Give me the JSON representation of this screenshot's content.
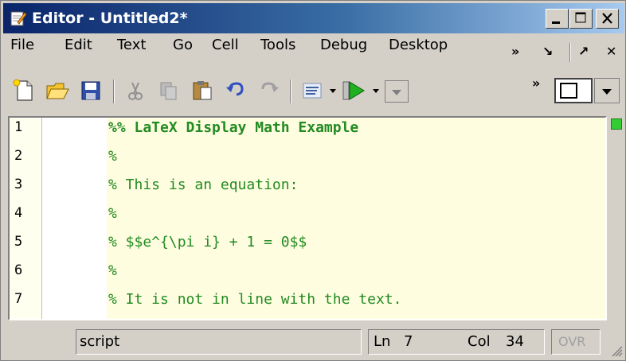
{
  "window": {
    "title": "Editor - Untitled2*"
  },
  "menu": {
    "items": [
      "File",
      "Edit",
      "Text",
      "Go",
      "Cell",
      "Tools",
      "Debug",
      "Desktop"
    ],
    "right": {
      "more": "»",
      "undock": "↘",
      "dock": "↗",
      "close": "✕"
    }
  },
  "toolbar": {
    "icons": [
      "new-file-icon",
      "open-folder-icon",
      "save-icon",
      "cut-icon",
      "copy-icon",
      "paste-icon",
      "undo-icon",
      "redo-icon",
      "comment-icon",
      "run-icon"
    ],
    "overflow": "»"
  },
  "editor": {
    "line_numbers": [
      "1",
      "2",
      "3",
      "4",
      "5",
      "6",
      "7"
    ],
    "lines": [
      "%% LaTeX Display Math Example",
      "%",
      "% This is an equation:",
      "%",
      "% $$e^{\\pi i} + 1 = 0$$",
      "%",
      "% It is not in line with the text."
    ],
    "code_color": "#228b22",
    "cell_bg": "#fffde0",
    "indicator_color": "#33cc33"
  },
  "status": {
    "mode": "script",
    "ln_label": "Ln",
    "ln_value": "7",
    "col_label": "Col",
    "col_value": "34",
    "ovr": "OVR"
  },
  "colors": {
    "titlebar_start": "#0a246a",
    "titlebar_end": "#a6caf0",
    "chrome": "#d4d0c8"
  }
}
